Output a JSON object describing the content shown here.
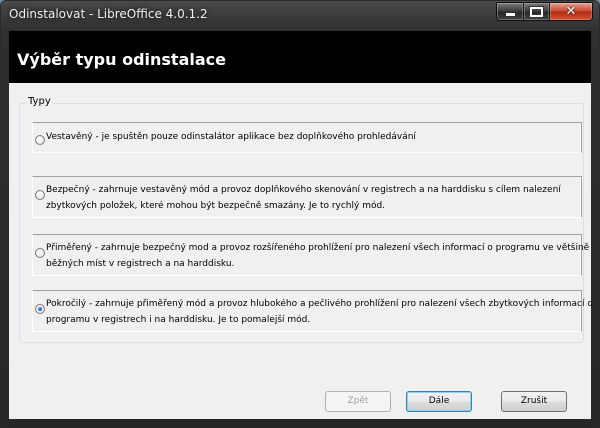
{
  "window": {
    "title": "Odinstalovat - LibreOffice 4.0.1.2"
  },
  "header": {
    "heading": "Výběr typu odinstalace"
  },
  "group": {
    "label": "Typy",
    "options": [
      {
        "lines": [
          "Vestavěný - je spuštěn pouze odinstalátor aplikace bez doplňkového prohledávání"
        ],
        "checked": false
      },
      {
        "lines": [
          "Bezpečný - zahrnuje vestavěný mód a provoz doplňkového skenování v registrech a na harddisku s cílem nalezení",
          "zbytkových položek, které mohou být bezpečně smazány. Je to rychlý mód."
        ],
        "checked": false
      },
      {
        "lines": [
          "Přiměřený - zahrnuje bezpečný mod a provoz rozšířeného prohlížení pro nalezení všech informací o programu ve většině",
          "běžných míst v registrech a na harddisku."
        ],
        "checked": false
      },
      {
        "lines": [
          "Pokročilý - zahrnuje přiměřený mód a provoz hlubokého a pečlivého prohlížení pro nalezení všech zbytkových informací o",
          "programu v registrech i na harddisku. Je to pomalejší mód."
        ],
        "checked": true
      }
    ]
  },
  "buttons": {
    "back": "Zpět",
    "next": "Dále",
    "cancel": "Zrušit"
  }
}
